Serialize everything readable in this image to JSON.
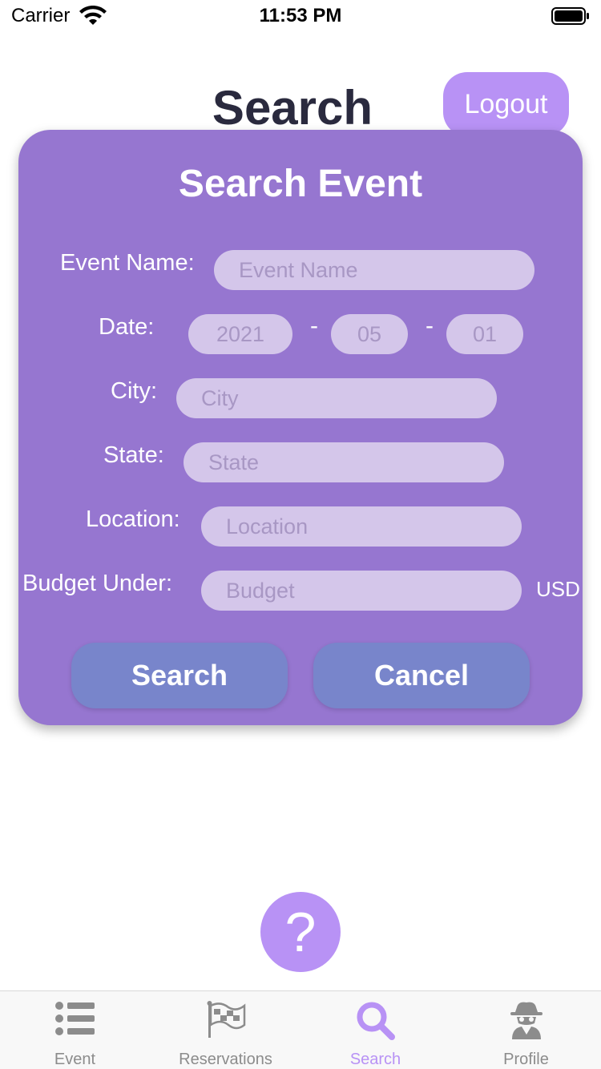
{
  "status_bar": {
    "carrier": "Carrier",
    "time": "11:53 PM",
    "wifi_icon": "wifi-icon",
    "battery_icon": "battery-icon"
  },
  "header": {
    "title": "Search",
    "logout_label": "Logout"
  },
  "card": {
    "title": "Search Event",
    "event_name": {
      "label": "Event Name:",
      "placeholder": "Event Name"
    },
    "date": {
      "label": "Date:",
      "year": "2021",
      "month": "05",
      "day": "01",
      "separator": "-"
    },
    "city": {
      "label": "City:",
      "placeholder": "City"
    },
    "state": {
      "label": "State:",
      "placeholder": "State"
    },
    "location": {
      "label": "Location:",
      "placeholder": "Location"
    },
    "budget": {
      "label": "Budget Under:",
      "placeholder": "Budget",
      "unit": "USD"
    },
    "search_label": "Search",
    "cancel_label": "Cancel"
  },
  "help": {
    "label": "?"
  },
  "tabs": [
    {
      "label": "Event",
      "icon": "list-icon",
      "active": false
    },
    {
      "label": "Reservations",
      "icon": "flag-icon",
      "active": false
    },
    {
      "label": "Search",
      "icon": "search-icon",
      "active": true
    },
    {
      "label": "Profile",
      "icon": "spy-icon",
      "active": false
    }
  ],
  "colors": {
    "accent": "#b892f5",
    "card": "#9676d0",
    "field": "#d4c6ea",
    "button": "#7885cb",
    "title": "#2a2a3e"
  }
}
